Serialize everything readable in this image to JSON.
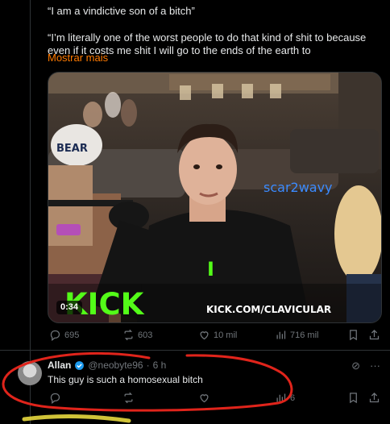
{
  "post": {
    "quote_line": "“I am a vindictive son of a bitch”",
    "body_line": "“I’m literally one of the worst people to do that kind of shit to because even if it costs me shit I will go to the ends of the earth to",
    "show_more": "Mostrar mais"
  },
  "video": {
    "duration": "0:34",
    "overlay_name": "scar2wavy",
    "overlay_letter": "I",
    "logo_text": "KICK",
    "channel_url": "KICK.COM/CLAVICULAR",
    "hat_text": "BEAR"
  },
  "post_actions": {
    "replies": "695",
    "reposts": "603",
    "likes": "10 mil",
    "views": "716 mil"
  },
  "reply": {
    "name": "Allan",
    "handle": "@neobyte96",
    "separator": "·",
    "time": "6 h",
    "text": "This guy is such a homosexual bitch",
    "views": "6"
  },
  "colors": {
    "accent": "#ff7a00",
    "kick_green": "#53fc18",
    "verified": "#1d9bf0",
    "overlay_blue": "#3b8bff",
    "markup_red": "#e0241b"
  },
  "icons": [
    "reply-icon",
    "repost-icon",
    "like-icon",
    "views-icon",
    "bookmark-icon",
    "share-icon",
    "grok-icon",
    "more-icon",
    "verified-icon"
  ]
}
